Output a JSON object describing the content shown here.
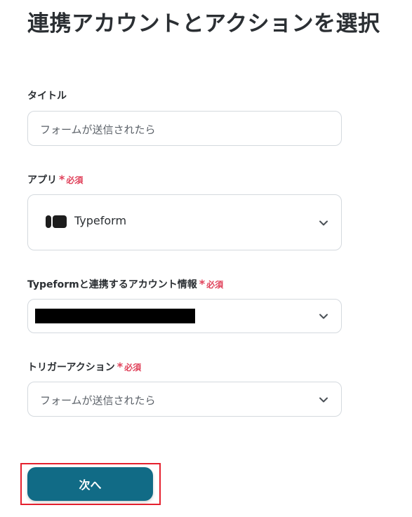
{
  "page": {
    "title": "連携アカウントとアクションを選択"
  },
  "form": {
    "title_field": {
      "label": "タイトル",
      "value": "フォームが送信されたら"
    },
    "app_field": {
      "label": "アプリ",
      "required_mark": "*",
      "required_text": "必須",
      "selected_app": "Typeform",
      "icon": "typeform-logo-icon"
    },
    "account_field": {
      "label": "Typeformと連携するアカウント情報",
      "required_mark": "*",
      "required_text": "必須"
    },
    "trigger_field": {
      "label": "トリガーアクション",
      "required_mark": "*",
      "required_text": "必須",
      "selected": "フォームが送信されたら"
    }
  },
  "actions": {
    "next_label": "次へ"
  },
  "colors": {
    "primary_button": "#116b86",
    "required": "#e0415a",
    "highlight_frame": "#e5202e",
    "input_border": "#d4d9de"
  }
}
